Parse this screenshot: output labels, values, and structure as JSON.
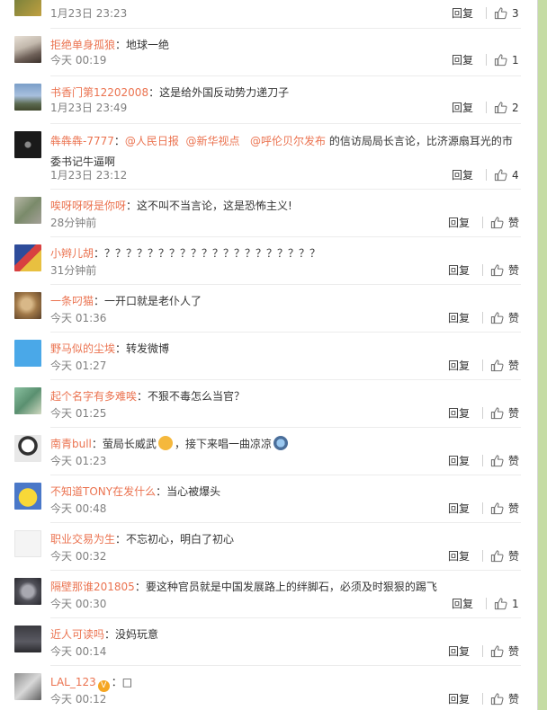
{
  "ui": {
    "reply_label": "回复",
    "like_label": "赞"
  },
  "comments": [
    {
      "user": "",
      "text": "",
      "time": "1月23日 23:23",
      "likes": "3"
    },
    {
      "user": "拒绝单身孤狼",
      "sep": "：",
      "text": "地球一绝",
      "time": "今天 00:19",
      "likes": "1"
    },
    {
      "user": "书香门第12202008",
      "sep": "：",
      "text": "这是给外国反动势力递刀子",
      "time": "1月23日 23:49",
      "likes": "2"
    },
    {
      "user": "犇犇犇-7777",
      "sep": "：",
      "mention1": "@人民日报",
      "mention2": "@新华视点",
      "mention3": "@呼伦贝尔发布",
      "text": " 的信访局局长言论，比济源扇耳光的市委书记牛逼啊",
      "time": "1月23日 23:12",
      "likes": "4"
    },
    {
      "user": "唉呀呀呀是你呀",
      "sep": "：",
      "text": "这不叫不当言论，这是恐怖主义!",
      "time": "28分钟前",
      "likes": "赞"
    },
    {
      "user": "小辫儿胡",
      "sep": "：",
      "text": "？？？？？？？？？？？？？？？？？？？？",
      "time": "31分钟前",
      "likes": "赞"
    },
    {
      "user": "一条叼猫",
      "sep": "：",
      "text": "一开口就是老仆人了",
      "time": "今天 01:36",
      "likes": "赞"
    },
    {
      "user": "野马似的尘埃",
      "sep": "：",
      "text": "转发微博",
      "time": "今天 01:27",
      "likes": "赞"
    },
    {
      "user": "起个名字有多难唉",
      "sep": "：",
      "text": "不狠不毒怎么当官？",
      "time": "今天 01:25",
      "likes": "赞"
    },
    {
      "user": "南青bull",
      "sep": "：",
      "text": "萤局长威武",
      "text2": "，接下来唱一曲凉凉",
      "time": "今天 01:23",
      "likes": "赞"
    },
    {
      "user": "不知道TONY在发什么",
      "sep": "：",
      "text": "当心被爆头",
      "time": "今天 00:48",
      "likes": "赞"
    },
    {
      "user": "职业交易为生",
      "sep": "：",
      "text": "不忘初心，明白了初心",
      "time": "今天 00:32",
      "likes": "赞"
    },
    {
      "user": "隔壁那谁201805",
      "sep": "：",
      "text": "要这种官员就是中国发展路上的绊脚石，必须及时狠狠的踢飞",
      "time": "今天 00:30",
      "likes": "1"
    },
    {
      "user": "近人可读吗",
      "sep": "：",
      "text": "没妈玩意",
      "time": "今天 00:14",
      "likes": "赞"
    },
    {
      "user": "LAL_123",
      "badge": "V",
      "sep": "：",
      "text": "□",
      "time": "今天 00:12",
      "likes": "赞"
    }
  ],
  "colors": {
    "username": "#eb7350",
    "text": "#333333",
    "meta": "#808080",
    "side_bar": "#c5dca4"
  }
}
